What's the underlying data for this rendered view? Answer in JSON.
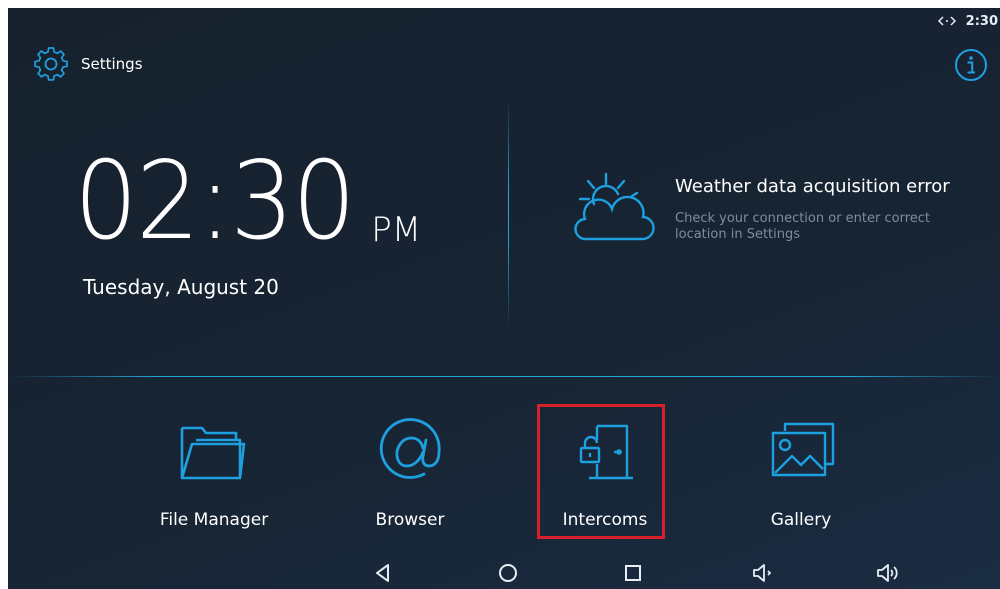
{
  "status_bar": {
    "connection_icon": "data-transfer-icon",
    "time": "2:30"
  },
  "header": {
    "settings_icon": "gear-icon",
    "settings_label": "Settings",
    "info_icon": "info-icon"
  },
  "clock": {
    "time": "02:30",
    "ampm": "PM",
    "date": "Tuesday, August 20"
  },
  "weather": {
    "icon": "partly-cloudy-icon",
    "title": "Weather data acquisition error",
    "message": "Check your connection or enter correct location in Settings"
  },
  "apps": [
    {
      "label": "File Manager",
      "icon": "folder-icon"
    },
    {
      "label": "Browser",
      "icon": "at-sign-icon"
    },
    {
      "label": "Intercoms",
      "icon": "door-lock-icon"
    },
    {
      "label": "Gallery",
      "icon": "gallery-icon"
    }
  ],
  "navigation": {
    "back_icon": "back-triangle-icon",
    "home_icon": "home-circle-icon",
    "recents_icon": "recents-square-icon",
    "volume_down_icon": "volume-down-icon",
    "volume_up_icon": "volume-up-icon"
  },
  "colors": {
    "accent": "#1ea0e0",
    "background": "#172433",
    "highlight_box": "#d6202a"
  }
}
